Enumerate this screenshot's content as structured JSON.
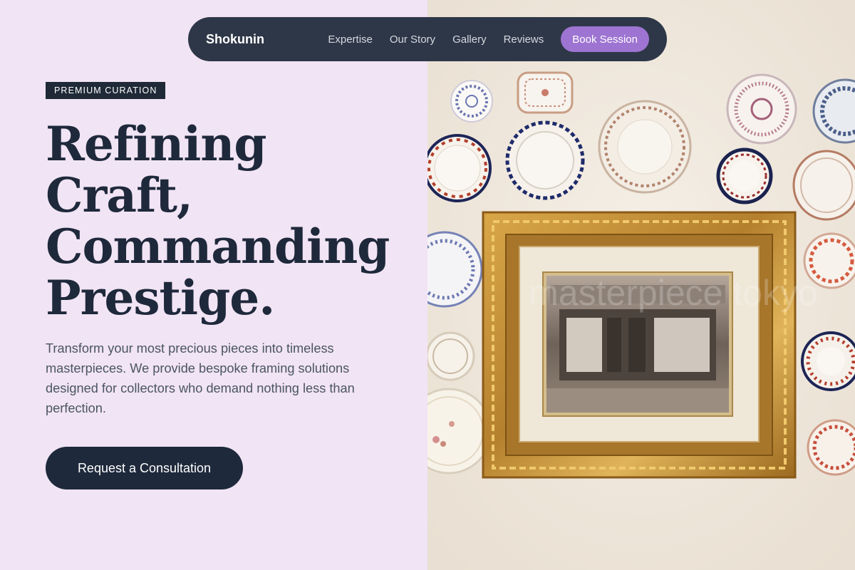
{
  "nav": {
    "brand": "Shokunin",
    "links": [
      "Expertise",
      "Our Story",
      "Gallery",
      "Reviews"
    ],
    "cta": "Book Session"
  },
  "hero": {
    "badge": "PREMIUM CURATION",
    "title_lines": [
      "Refining",
      "Craft,",
      "Commanding",
      "Prestige."
    ],
    "description": "Transform your most precious pieces into timeless masterpieces. We provide bespoke framing solutions designed for collectors who demand nothing less than perfection.",
    "cta": "Request a Consultation"
  },
  "image": {
    "watermark": "masterpiece tokyo",
    "alt": "Gilded antique frame surrounded by decorative porcelain plates on a wall"
  },
  "colors": {
    "left_background": "#f1e4f4",
    "navy": "#1e293b",
    "nav_background": "#2e3748",
    "accent_purple": "#9e74d2",
    "gold_frame": "#c08a2c"
  }
}
